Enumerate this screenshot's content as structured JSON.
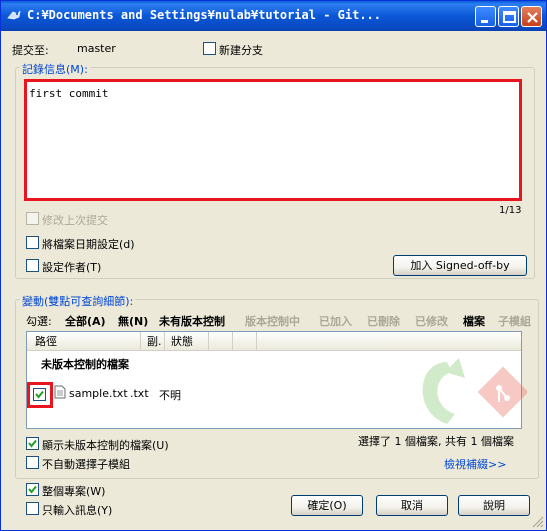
{
  "window": {
    "title": "C:¥Documents and Settings¥nulab¥tutorial - Git...",
    "minimize_label": "minimize",
    "maximize_label": "maximize",
    "close_label": "close"
  },
  "commit_to": {
    "label": "提交至:",
    "branch": "master",
    "new_branch_label": "新建分支",
    "new_branch_checked": false
  },
  "message": {
    "group_label": "記錄信息(M):",
    "value": "first commit",
    "counter": "1/13"
  },
  "options": {
    "amend_label": "修改上次提交",
    "amend_checked": false,
    "set_date_label": "將檔案日期設定(d)",
    "set_date_checked": false,
    "set_author_label": "設定作者(T)",
    "set_author_checked": false,
    "signoff_button": "加入 Signed-off-by"
  },
  "changes": {
    "group_label": "變動(雙點可查詢細節):",
    "check_label": "勾選:",
    "filters": [
      {
        "label": "全部(A)",
        "state": "bold"
      },
      {
        "label": "無(N)",
        "state": "bold"
      },
      {
        "label": "未有版本控制",
        "state": "bold"
      },
      {
        "label": "版本控制中",
        "state": "disabled"
      },
      {
        "label": "已加入",
        "state": "disabled"
      },
      {
        "label": "已刪除",
        "state": "disabled"
      },
      {
        "label": "已修改",
        "state": "disabled"
      },
      {
        "label": "檔案",
        "state": "bold"
      },
      {
        "label": "子模組",
        "state": "disabled"
      }
    ],
    "columns": {
      "path": "路徑",
      "ext": "副.",
      "status": "狀態"
    },
    "group_header": "未版本控制的檔案",
    "files": [
      {
        "name": "sample.txt",
        "ext": ".txt",
        "status": "不明",
        "checked": true
      }
    ],
    "show_unversioned_label": "顯示未版本控制的檔案(U)",
    "show_unversioned_checked": true,
    "no_autoselect_submodules_label": "不自動選擇子模組",
    "no_autoselect_submodules_checked": false,
    "selection_summary": "選擇了 1 個檔案, 共有 1 個檔案",
    "view_patch_link": "檢視補綴>>"
  },
  "bottom": {
    "whole_project_label": "整個專案(W)",
    "whole_project_checked": true,
    "message_only_label": "只輸入訊息(Y)",
    "message_only_checked": false,
    "ok_button": "確定(O)",
    "cancel_button": "取消",
    "help_button": "說明"
  },
  "colors": {
    "title_bar": "#0a5bd8",
    "highlight_red": "#e8141e",
    "link_blue": "#0046d5",
    "dialog_bg": "#ece9d8"
  }
}
